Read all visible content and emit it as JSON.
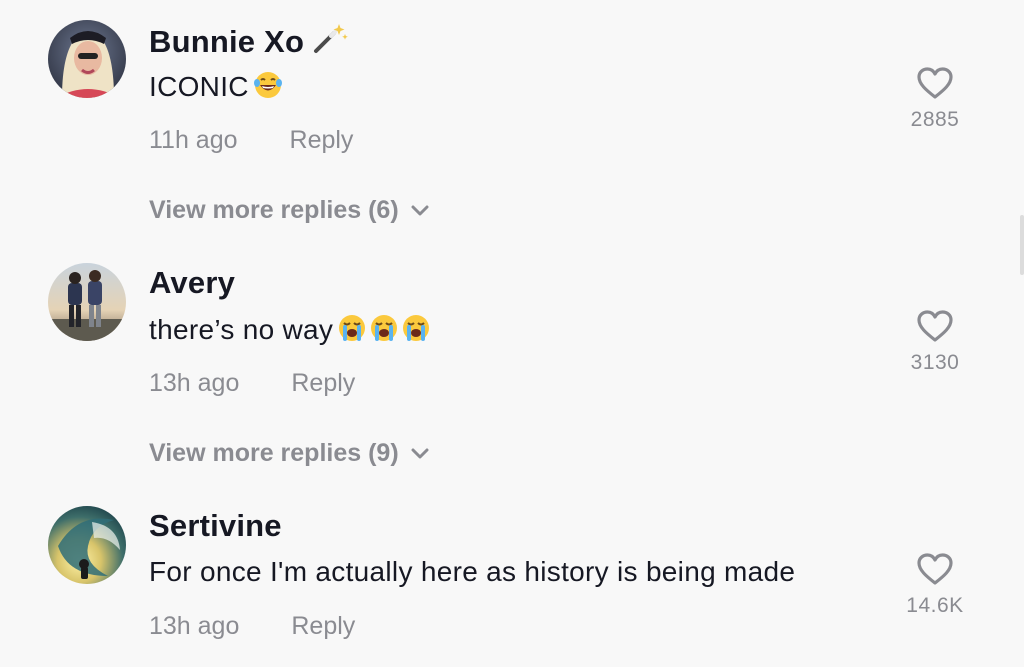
{
  "comments": [
    {
      "username": "Bunnie Xo",
      "text": "ICONIC",
      "emojis": [
        "laughing-tears-emoji"
      ],
      "time": "11h ago",
      "reply_label": "Reply",
      "likes": "2885",
      "view_more": "View more replies (6)"
    },
    {
      "username": "Avery",
      "text": "there’s no way",
      "emojis": [
        "loudly-crying-emoji",
        "loudly-crying-emoji",
        "loudly-crying-emoji"
      ],
      "time": "13h ago",
      "reply_label": "Reply",
      "likes": "3130",
      "view_more": "View more replies (9)"
    },
    {
      "username": "Sertivine",
      "text": "For once I'm actually here as history is being made",
      "emojis": [],
      "time": "13h ago",
      "reply_label": "Reply",
      "likes": "14.6K"
    }
  ],
  "colors": {
    "background": "#f8f8f8",
    "primary_text": "#161823",
    "secondary_text": "#8a8b91"
  }
}
